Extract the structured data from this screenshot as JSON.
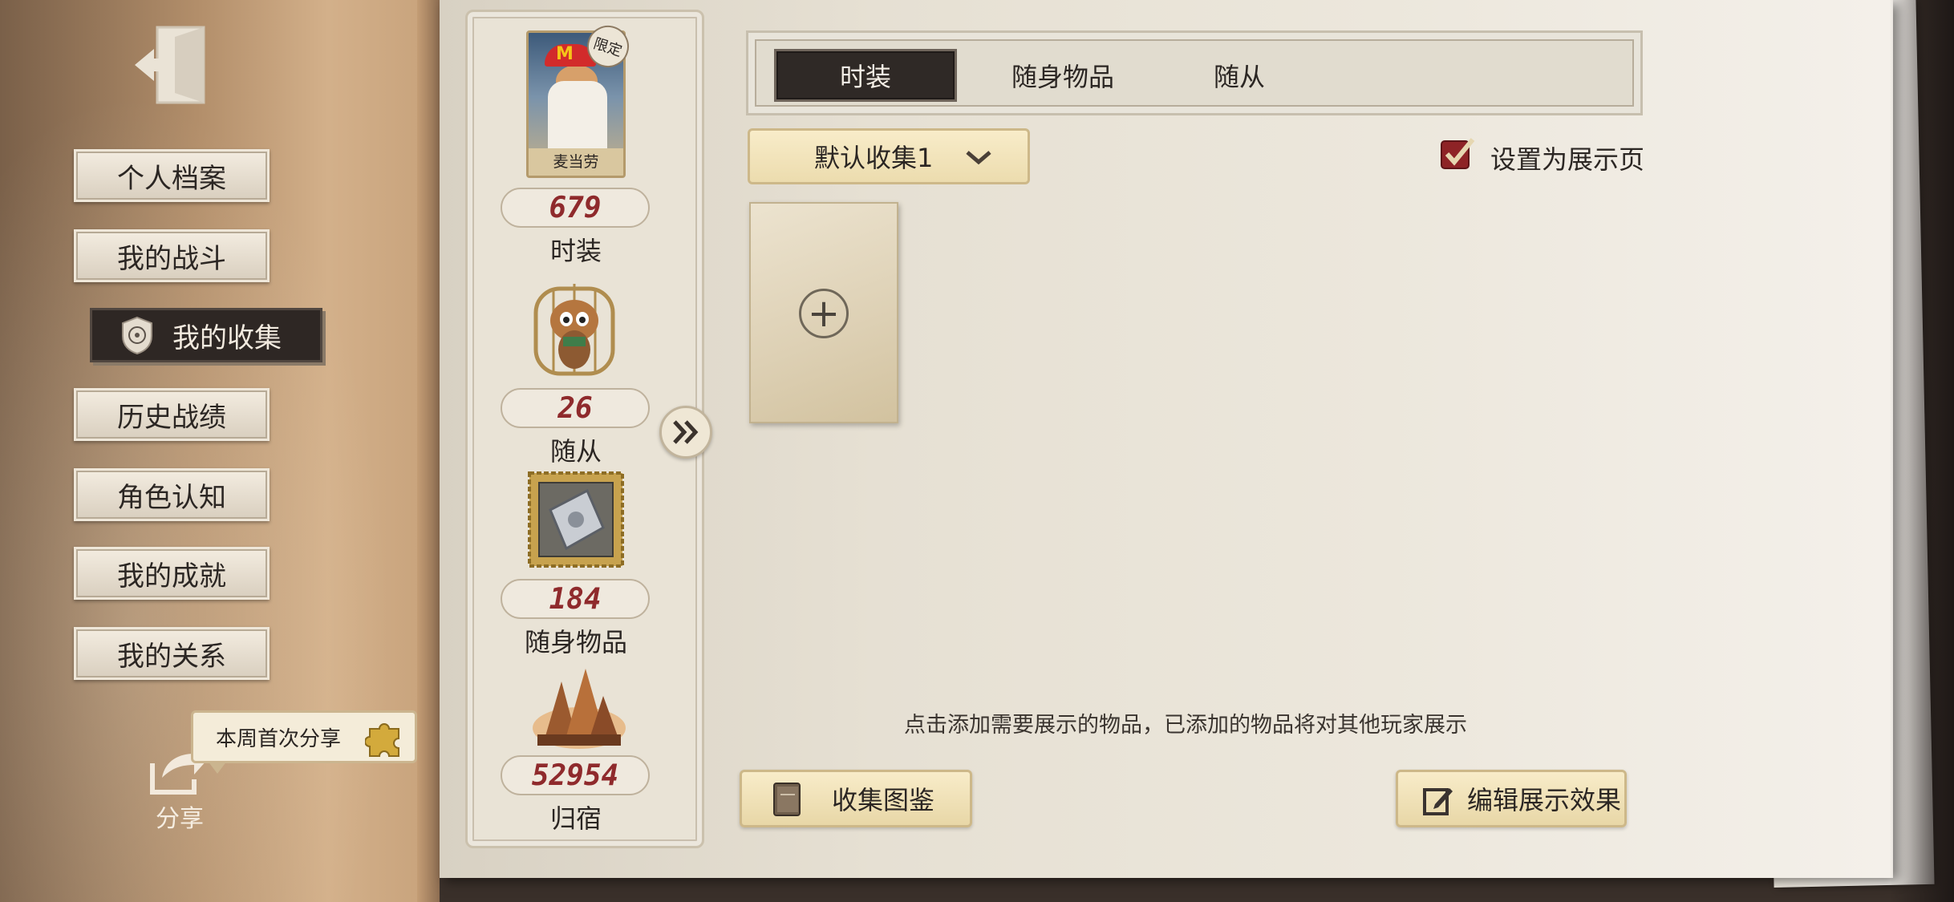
{
  "sidebar": {
    "menu_items": [
      {
        "label": "个人档案"
      },
      {
        "label": "我的战斗"
      },
      {
        "label": "我的收集"
      },
      {
        "label": "历史战绩"
      },
      {
        "label": "角色认知"
      },
      {
        "label": "我的成就"
      },
      {
        "label": "我的关系"
      }
    ],
    "active_index": 2,
    "share_bubble": "本周首次分享",
    "share_label": "分享"
  },
  "stats": {
    "costume_name": "麦当劳",
    "limited_tag": "限定",
    "items": [
      {
        "count": "679",
        "label": "时装"
      },
      {
        "count": "26",
        "label": "随从"
      },
      {
        "count": "184",
        "label": "随身物品"
      },
      {
        "count": "52954",
        "label": "归宿"
      }
    ]
  },
  "tabs": [
    {
      "label": "时装",
      "active": true
    },
    {
      "label": "随身物品",
      "active": false
    },
    {
      "label": "随从",
      "active": false
    }
  ],
  "collection_select": {
    "value": "默认收集1"
  },
  "showcase": {
    "label": "设置为展示页",
    "checked": true
  },
  "add_slot": {
    "symbol": "+"
  },
  "hint": "点击添加需要展示的物品，已添加的物品将对其他玩家展示",
  "buttons": {
    "collection_book": "收集图鉴",
    "edit_display": "编辑展示效果"
  },
  "colors": {
    "count_text": "#8f2a2c",
    "checkbox": "#8e2326",
    "active_tab": "#2f2926"
  }
}
